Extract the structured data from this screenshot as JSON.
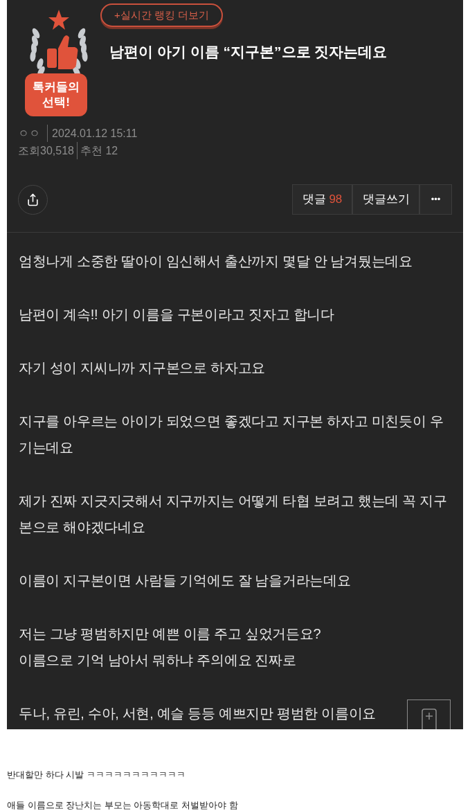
{
  "ranking_button": "+실시간 랭킹 더보기",
  "badge": {
    "lines": [
      "톡커들의",
      "선택!"
    ]
  },
  "title": "남편이 아기 이름 “지구본”으로 짓자는데요",
  "author": "ㅇㅇ",
  "date": "2024.01.12 15:11",
  "views_label": "조회",
  "views": "30,518",
  "recommend_label": "추천",
  "recommend": "12",
  "actions": {
    "comments_label": "댓글",
    "comments_count": "98",
    "write_comment": "댓글쓰기",
    "more": "•••"
  },
  "paragraphs": [
    {
      "lines": [
        "엄청나게 소중한 딸아이 임신해서 출산까지 몇달 안 남겨뒀는데요"
      ]
    },
    {
      "lines": [
        "남편이 계속!! 아기 이름을 구본이라고 짓자고 합니다"
      ]
    },
    {
      "lines": [
        "자기 성이 지씨니까 지구본으로 하자고요"
      ]
    },
    {
      "lines": [
        "지구를 아우르는 아이가 되었으면 좋겠다고 지구본 하자고 미친듯이 우기는데요"
      ]
    },
    {
      "lines": [
        "제가 진짜 지긋지긋해서 지구까지는 어떻게 타협 보려고 했는데 꼭 지구본으로 해야겠다네요"
      ]
    },
    {
      "lines": [
        "이름이 지구본이면 사람들 기억에도 잘 남을거라는데요"
      ]
    },
    {
      "lines": [
        "저는 그냥 평범하지만 예쁜 이름 주고 싶었거든요?",
        "이름으로 기억 남아서 뭐하냐 주의에요 진짜로"
      ]
    },
    {
      "lines": [
        "두나, 유린, 수아, 서현, 예슬 등등 예쁘지만 평범한 이름이요"
      ]
    }
  ],
  "comments": [
    "반대할만 하다 시발 ㅋㅋㅋㅋㅋㅋㅋㅋㅋㅋㅋ",
    "애들 이름으로 장난치는 부모는 아동학대로 처벌받아야 함"
  ]
}
